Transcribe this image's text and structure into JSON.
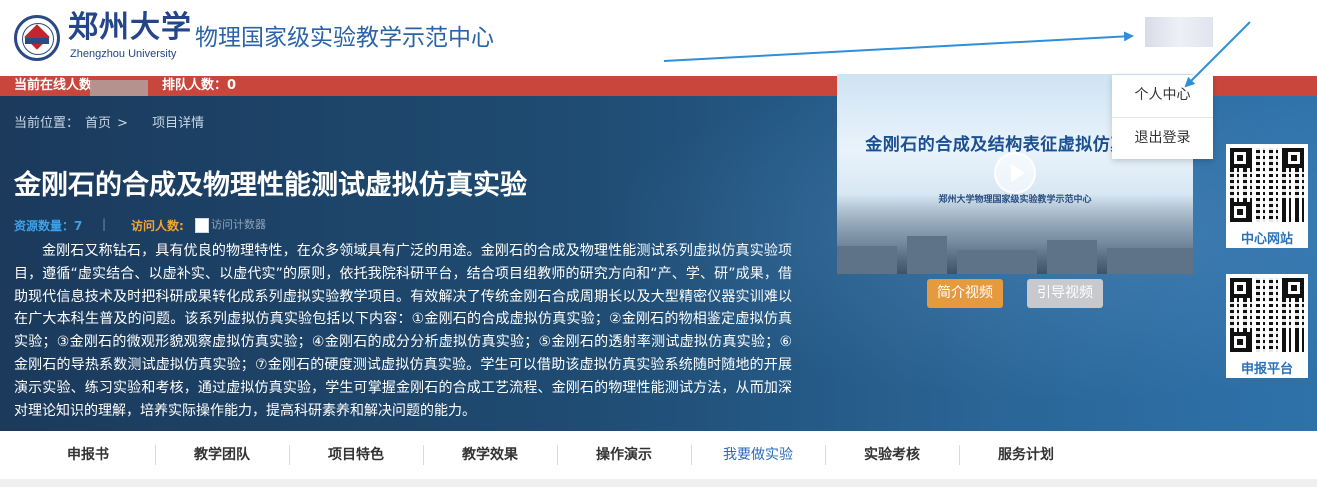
{
  "brand": {
    "university_cn": "郑州大学",
    "university_en": "Zhengzhou University",
    "site_title": "物理国家级实验教学示范中心"
  },
  "status_bar": {
    "online_label": "当前在线人数",
    "queue_label": "排队人数：0"
  },
  "breadcrumb": {
    "label": "当前位置：",
    "home": "首页",
    "separator": ">",
    "current": "项目详情"
  },
  "project": {
    "title": "金刚石的合成及物理性能测试虚拟仿真实验",
    "resource_count": "资源数量：7",
    "meta_separator": "|",
    "visits_label": "访问人数:",
    "visits_image_alt": "访问计数器",
    "description": "金刚石又称钻石，具有优良的物理特性，在众多领域具有广泛的用途。金刚石的合成及物理性能测试系列虚拟仿真实验项目，遵循“虚实结合、以虚补实、以虚代实”的原则，依托我院科研平台，结合项目组教师的研究方向和“产、学、研”成果，借助现代信息技术及时把科研成果转化成系列虚拟实验教学项目。有效解决了传统金刚石合成周期长以及大型精密仪器实训难以在广大本科生普及的问题。该系列虚拟仿真实验包括以下内容：①金刚石的合成虚拟仿真实验；②金刚石的物相鉴定虚拟仿真实验；③金刚石的微观形貌观察虚拟仿真实验；④金刚石的成分分析虚拟仿真实验；⑤金刚石的透射率测试虚拟仿真实验；⑥金刚石的导热系数测试虚拟仿真实验；⑦金刚石的硬度测试虚拟仿真实验。学生可以借助该虚拟仿真实验系统随时随地的开展演示实验、练习实验和考核，通过虚拟仿真实验，学生可掌握金刚石的合成工艺流程、金刚石的物理性能测试方法，从而加深对理论知识的理解，培养实际操作能力，提高科研素养和解决问题的能力。"
  },
  "video": {
    "title": "金刚石的合成及结构表征虚拟仿真实验",
    "subtitle": "郑州大学物理国家级实验教学示范中心",
    "intro_button": "简介视频",
    "guide_button": "引导视频"
  },
  "qr": {
    "center_label": "中心网站",
    "apply_label": "申报平台"
  },
  "user_menu": {
    "items": [
      "个人中心",
      "退出登录"
    ]
  },
  "nav": {
    "items": [
      "申报书",
      "教学团队",
      "项目特色",
      "教学效果",
      "操作演示",
      "我要做实验",
      "实验考核",
      "服务计划"
    ],
    "active_index": 5
  },
  "colors": {
    "brand_blue": "#24458a",
    "status_red": "#c9463c",
    "hero_dark": "#1b3a5c",
    "accent_orange": "#e69a3e",
    "annotation_arrow": "#2f8fd8"
  }
}
